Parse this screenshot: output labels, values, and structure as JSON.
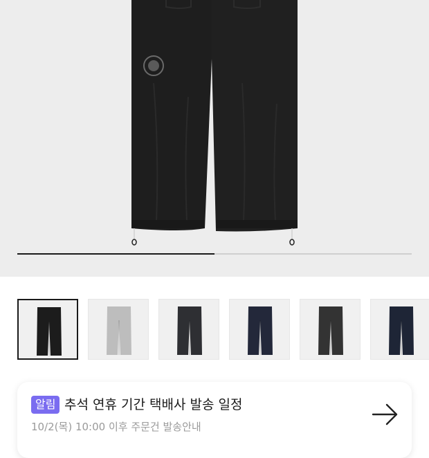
{
  "gallery": {
    "image_count": 6,
    "selected_index": 0,
    "progress_fraction": 0.5
  },
  "thumbnails": [
    {
      "color_name": "black",
      "color": "#1c1c1c"
    },
    {
      "color_name": "melange-gray",
      "color": "#bdbdbd"
    },
    {
      "color_name": "charcoal",
      "color": "#2e2f33"
    },
    {
      "color_name": "navy",
      "color": "#23283a"
    },
    {
      "color_name": "dark-gray",
      "color": "#333333"
    },
    {
      "color_name": "dark-navy",
      "color": "#1e2536"
    }
  ],
  "notice": {
    "badge": "알림",
    "title": "추석 연휴 기간 택배사 발송 일정",
    "subtitle": "10/2(목) 10:00 이후 주문건 발송안내"
  },
  "colors": {
    "accent": "#7a6cf0",
    "hero_bg": "#ededed"
  }
}
